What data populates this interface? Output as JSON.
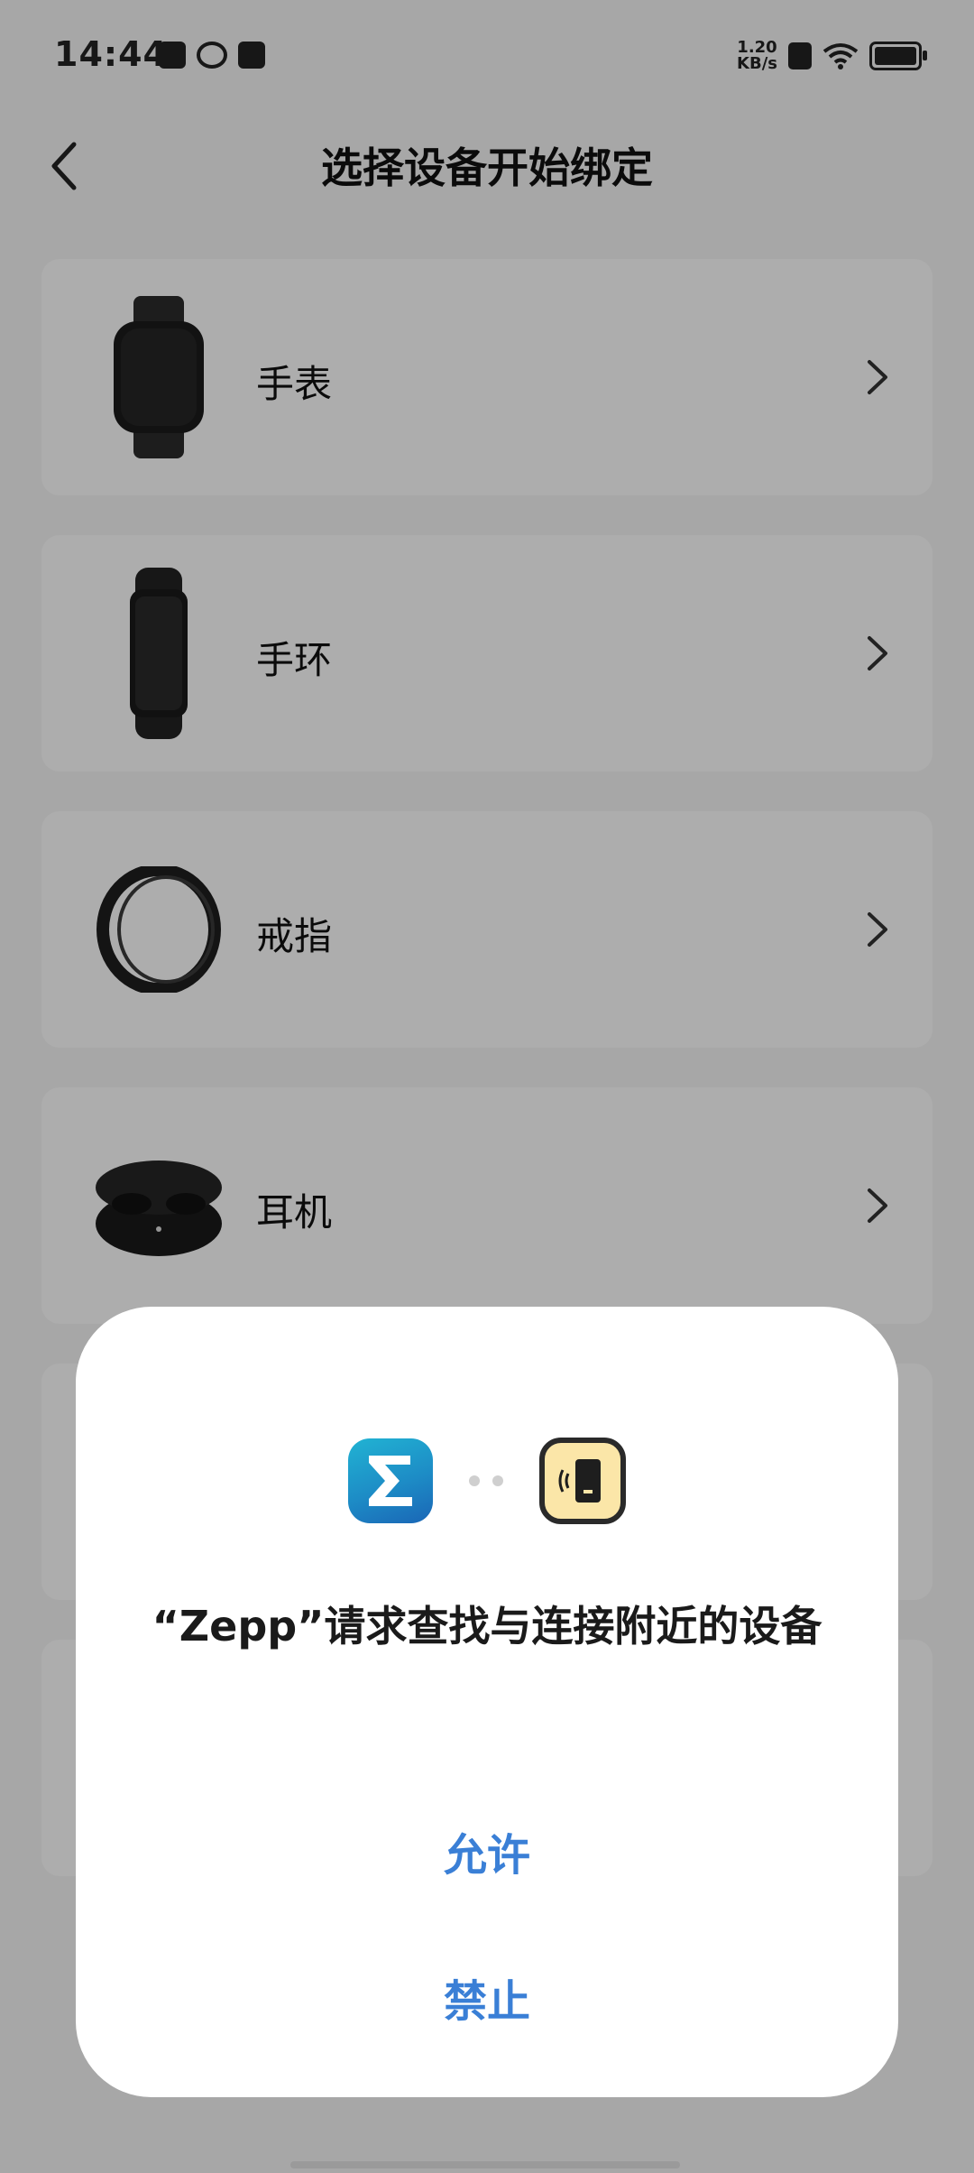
{
  "status_bar": {
    "time": "14:44",
    "net_speed_value": "1.20",
    "net_speed_unit": "KB/s",
    "icons": [
      "notification-icon",
      "app-icon",
      "message-icon",
      "sim-off-icon",
      "wifi-icon",
      "battery-icon"
    ]
  },
  "header": {
    "title": "选择设备开始绑定",
    "back_icon": "back-arrow-icon"
  },
  "devices": [
    {
      "label": "手表",
      "icon": "watch-image"
    },
    {
      "label": "手环",
      "icon": "band-image"
    },
    {
      "label": "戒指",
      "icon": "ring-image"
    },
    {
      "label": "耳机",
      "icon": "earbuds-image"
    }
  ],
  "dialog": {
    "message": "“Zepp”请求查找与连接附近的设备",
    "allow_label": "允许",
    "deny_label": "禁止",
    "colors": {
      "button": "#3a7fd6",
      "zepp_icon": "#1d8cc6",
      "nearby_icon": "#fbe6a8"
    }
  }
}
